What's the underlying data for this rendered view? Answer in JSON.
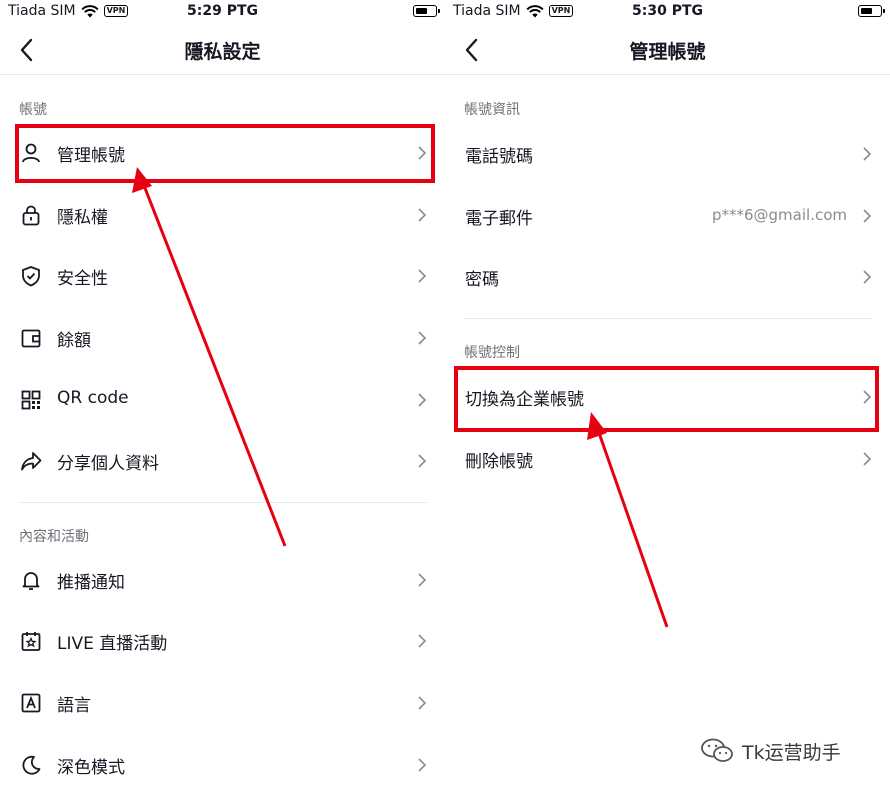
{
  "left": {
    "status": {
      "carrier": "Tiada SIM",
      "vpn": "VPN",
      "time": "5:29 PTG"
    },
    "title": "隱私設定",
    "sections": [
      {
        "header": "帳號",
        "items": [
          {
            "label": "管理帳號",
            "icon": "person-icon"
          },
          {
            "label": "隱私權",
            "icon": "lock-icon"
          },
          {
            "label": "安全性",
            "icon": "shield-icon"
          },
          {
            "label": "餘額",
            "icon": "wallet-icon"
          },
          {
            "label": "QR code",
            "icon": "qr-code-icon"
          },
          {
            "label": "分享個人資料",
            "icon": "share-icon"
          }
        ]
      },
      {
        "header": "內容和活動",
        "items": [
          {
            "label": "推播通知",
            "icon": "bell-icon"
          },
          {
            "label": "LIVE 直播活動",
            "icon": "live-calendar-icon"
          },
          {
            "label": "語言",
            "icon": "language-icon"
          },
          {
            "label": "深色模式",
            "icon": "moon-icon"
          }
        ]
      }
    ]
  },
  "right": {
    "status": {
      "carrier": "Tiada SIM",
      "vpn": "VPN",
      "time": "5:30 PTG"
    },
    "title": "管理帳號",
    "sections": [
      {
        "header": "帳號資訊",
        "items": [
          {
            "label": "電話號碼",
            "value": ""
          },
          {
            "label": "電子郵件",
            "value": "p***6@gmail.com"
          },
          {
            "label": "密碼",
            "value": ""
          }
        ]
      },
      {
        "header": "帳號控制",
        "items": [
          {
            "label": "切換為企業帳號",
            "value": ""
          },
          {
            "label": "刪除帳號",
            "value": ""
          }
        ]
      }
    ]
  },
  "watermark": "Tk运营助手",
  "colors": {
    "highlight": "#e60012",
    "text": "#161823",
    "secondary": "#8a8b91"
  }
}
